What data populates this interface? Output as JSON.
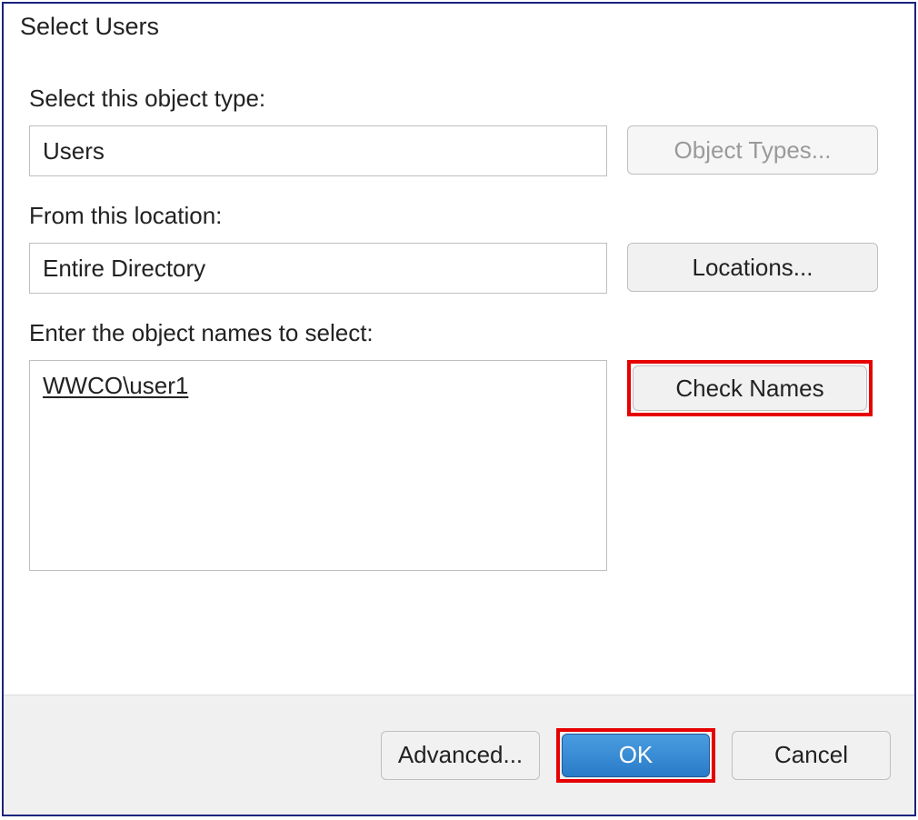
{
  "dialog": {
    "title": "Select Users"
  },
  "object_type": {
    "label": "Select this object type:",
    "value": "Users",
    "button": "Object Types..."
  },
  "location": {
    "label": "From this location:",
    "value": "Entire Directory",
    "button": "Locations..."
  },
  "names": {
    "label": "Enter the object names to select:",
    "value": "WWCO\\user1",
    "button": "Check Names"
  },
  "footer": {
    "advanced": "Advanced...",
    "ok": "OK",
    "cancel": "Cancel"
  }
}
